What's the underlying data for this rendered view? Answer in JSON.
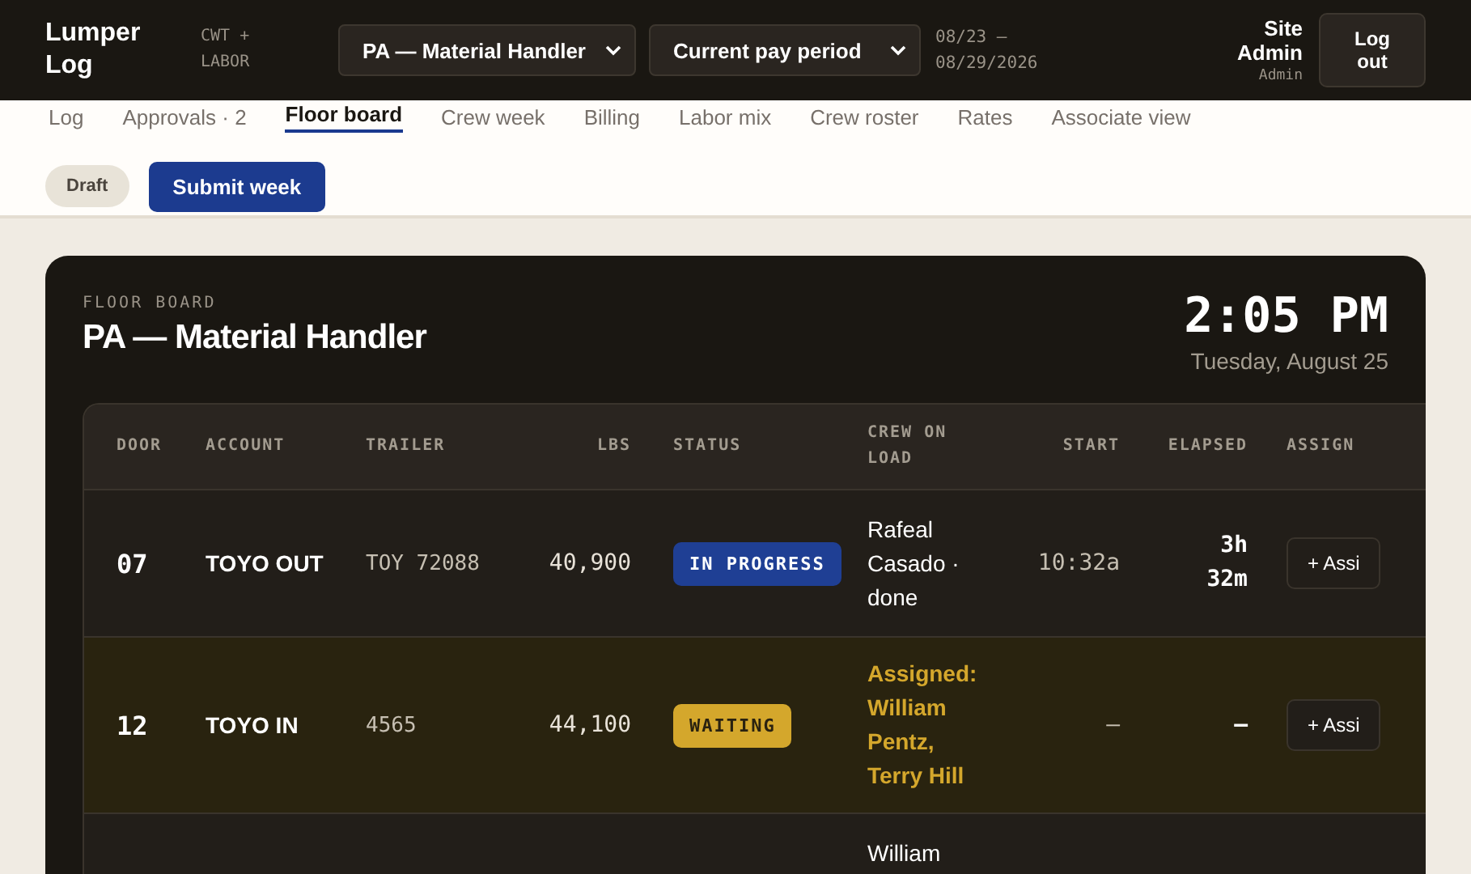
{
  "header": {
    "logo": "Lumper Log",
    "subtitle": "CWT + LABOR",
    "role_select": "PA — Material Handler",
    "period_select": "Current pay period",
    "period_range": "08/23 – 08/29/2026",
    "user_name": "Site Admin",
    "user_role": "Admin",
    "logout": "Log out"
  },
  "tabs": [
    {
      "label": "Log",
      "selected": false
    },
    {
      "label": "Approvals · 2",
      "selected": false
    },
    {
      "label": "Floor board",
      "selected": true
    },
    {
      "label": "Crew week",
      "selected": false
    },
    {
      "label": "Billing",
      "selected": false
    },
    {
      "label": "Labor mix",
      "selected": false
    },
    {
      "label": "Crew roster",
      "selected": false
    },
    {
      "label": "Rates",
      "selected": false
    },
    {
      "label": "Associate view",
      "selected": false
    }
  ],
  "week_status": "Draft",
  "submit_button": "Submit week",
  "board": {
    "eyebrow": "FLOOR BOARD",
    "title": "PA — Material Handler",
    "time": "2:05 PM",
    "date": "Tuesday, August 25",
    "columns": [
      "DOOR",
      "ACCOUNT",
      "TRAILER",
      "LBS",
      "STATUS",
      "CREW ON LOAD",
      "START",
      "ELAPSED",
      "ASSIGN"
    ],
    "rows": [
      {
        "door": "07",
        "account": "TOYO OUT",
        "trailer": "TOY 72088",
        "lbs": "40,900",
        "status": "IN PROGRESS",
        "kind": "in_progress",
        "crew": "Rafeal Casado · done",
        "start": "10:32a",
        "elapsed": "3h 32m",
        "assign": "+ Assi"
      },
      {
        "door": "12",
        "account": "TOYO IN",
        "trailer": "4565",
        "lbs": "44,100",
        "status": "WAITING",
        "kind": "waiting",
        "crew": "Assigned: William Pentz, Terry Hill",
        "start": "—",
        "elapsed": "—",
        "assign": "+ Assi"
      },
      {
        "door": "",
        "account": "",
        "trailer": "",
        "lbs": "",
        "status": "",
        "kind": "partial",
        "crew": "William",
        "start": "",
        "elapsed": "",
        "assign": ""
      }
    ]
  }
}
